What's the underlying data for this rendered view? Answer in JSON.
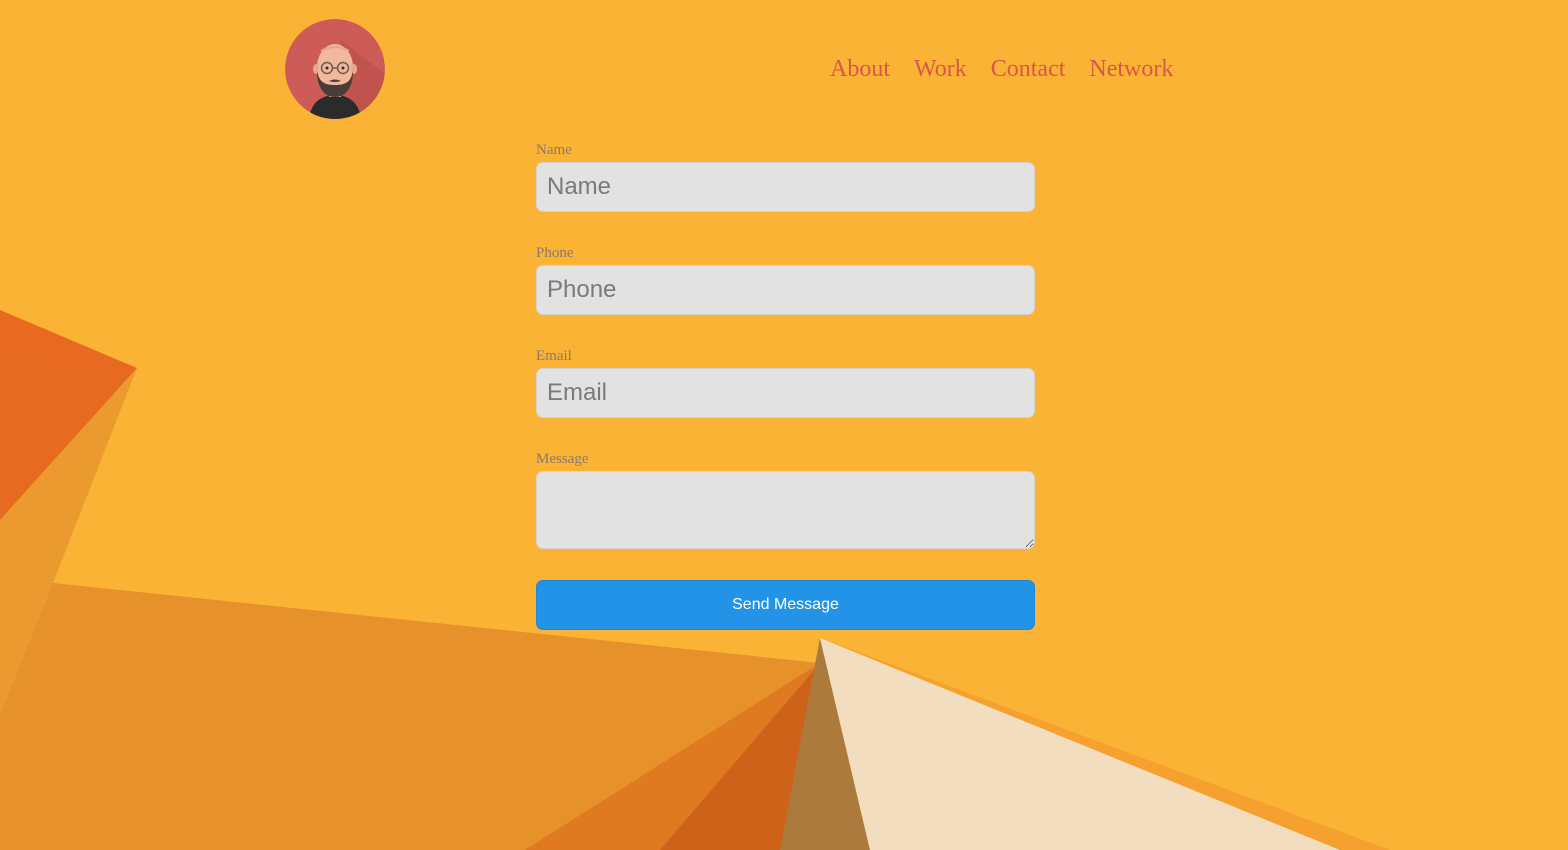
{
  "colors": {
    "background": "#FAB334",
    "nav_link": "#D9574A",
    "button": "#2393E8",
    "input_bg": "#E2E2E2",
    "label": "#8A7B6B"
  },
  "header": {
    "avatar_icon": "avatar-illustration-icon",
    "nav": [
      {
        "label": "About"
      },
      {
        "label": "Work"
      },
      {
        "label": "Contact"
      },
      {
        "label": "Network"
      }
    ]
  },
  "form": {
    "name": {
      "label": "Name",
      "placeholder": "Name"
    },
    "phone": {
      "label": "Phone",
      "placeholder": "Phone"
    },
    "email": {
      "label": "Email",
      "placeholder": "Email"
    },
    "message": {
      "label": "Message",
      "placeholder": ""
    },
    "submit_label": "Send Message"
  }
}
